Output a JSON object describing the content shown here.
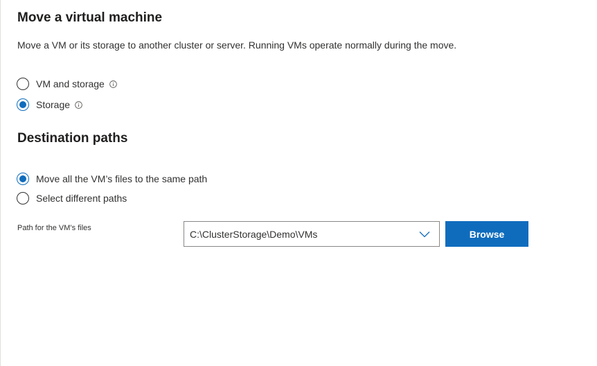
{
  "header": {
    "title": "Move a virtual machine",
    "description": "Move a VM or its storage to another cluster or server. Running VMs operate normally during the move."
  },
  "move_type": {
    "options": [
      {
        "label": "VM and storage",
        "selected": false,
        "info_icon": "info-icon"
      },
      {
        "label": "Storage",
        "selected": true,
        "info_icon": "info-icon"
      }
    ]
  },
  "destination": {
    "title": "Destination paths",
    "options": [
      {
        "label": "Move all the VM’s files to the same path",
        "selected": true
      },
      {
        "label": "Select different paths",
        "selected": false
      }
    ],
    "path_label": "Path for the VM’s files",
    "path_value": "C:\\ClusterStorage\\Demo\\VMs",
    "browse_label": "Browse"
  },
  "colors": {
    "accent": "#0f6cbd",
    "text": "#323130",
    "border": "#8a8886"
  }
}
